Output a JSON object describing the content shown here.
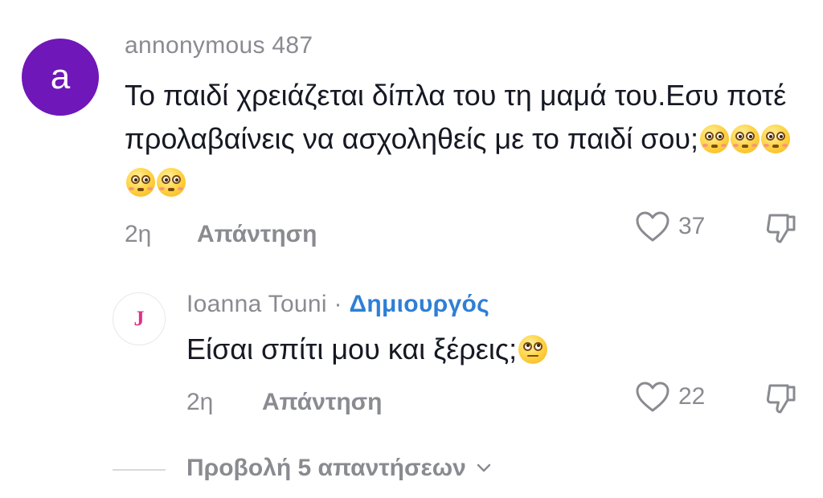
{
  "comment": {
    "avatar_letter": "a",
    "avatar_color": "#6f17b8",
    "username": "annonymous 487",
    "text": "Το παιδί χρειάζεται δίπλα του τη μαμά του.Εσυ ποτέ προλαβαίνεις να ασχοληθείς με το παιδί σου;",
    "emojis": [
      "flushed-face",
      "flushed-face",
      "flushed-face",
      "flushed-face",
      "flushed-face"
    ],
    "time": "2η",
    "reply_label": "Απάντηση",
    "likes": "37"
  },
  "reply": {
    "avatar_letter": "J",
    "username": "Ioanna Touni",
    "separator": "·",
    "creator_badge": "Δημιουργός",
    "creator_color": "#2e7fd6",
    "text": "Είσαι σπίτι μου και ξέρεις;",
    "emoji": "face-with-rolling-eyes",
    "time": "2η",
    "reply_label": "Απάντηση",
    "likes": "22"
  },
  "view_replies": {
    "label": "Προβολή 5 απαντήσεων"
  }
}
